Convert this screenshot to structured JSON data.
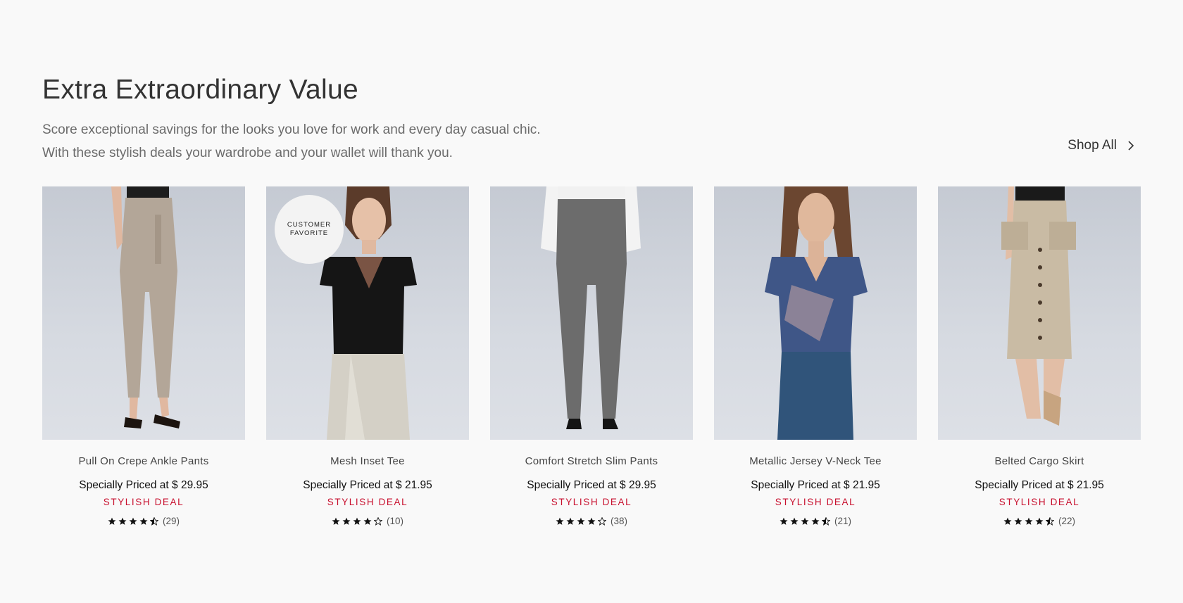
{
  "section": {
    "title": "Extra Extraordinary Value",
    "subtitle_line1": "Score exceptional savings for the looks you love for work and every day casual chic.",
    "subtitle_line2": "With these stylish deals your wardrobe and your wallet will thank you.",
    "shop_all_label": "Shop All"
  },
  "products": [
    {
      "name": "Pull On Crepe Ankle Pants",
      "price": "Specially Priced at $ 29.95",
      "deal": "STYLISH DEAL",
      "rating": 4.5,
      "reviews": "(29)",
      "badge": ""
    },
    {
      "name": "Mesh Inset Tee",
      "price": "Specially Priced at $ 21.95",
      "deal": "STYLISH DEAL",
      "rating": 4,
      "reviews": "(10)",
      "badge": "CUSTOMER FAVORITE"
    },
    {
      "name": "Comfort Stretch Slim Pants",
      "price": "Specially Priced at $ 29.95",
      "deal": "STYLISH DEAL",
      "rating": 4,
      "reviews": "(38)",
      "badge": ""
    },
    {
      "name": "Metallic Jersey V-Neck Tee",
      "price": "Specially Priced at $ 21.95",
      "deal": "STYLISH DEAL",
      "rating": 4.5,
      "reviews": "(21)",
      "badge": ""
    },
    {
      "name": "Belted Cargo Skirt",
      "price": "Specially Priced at $ 21.95",
      "deal": "STYLISH DEAL",
      "rating": 4.5,
      "reviews": "(22)",
      "badge": ""
    }
  ],
  "badge": {
    "line1": "CUSTOMER",
    "line2": "FAVORITE"
  },
  "icons": {
    "shop_all": "chevron-right-icon",
    "star": "star-icon",
    "half_star": "star-half-icon",
    "empty_star": "star-outline-icon"
  },
  "colors": {
    "deal": "#c8102e",
    "background": "#f9f9f9",
    "text": "#333333"
  }
}
